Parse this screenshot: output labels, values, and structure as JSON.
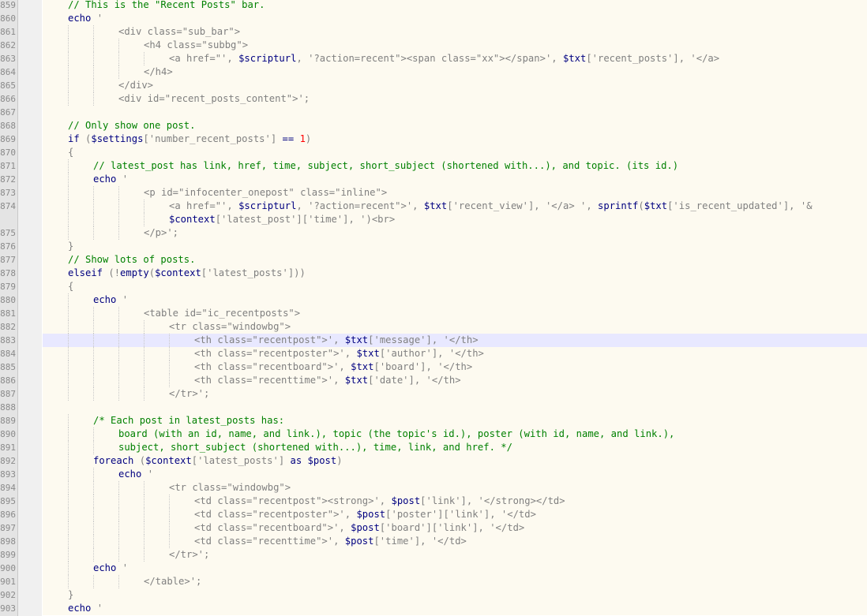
{
  "editor": {
    "language": "php",
    "lines": [
      {
        "n": "859",
        "indent": 1,
        "tokens": [
          [
            "cm",
            "// This is the \"Recent Posts\" bar."
          ]
        ]
      },
      {
        "n": "860",
        "indent": 1,
        "tokens": [
          [
            "kw",
            "echo"
          ],
          [
            "str",
            " '"
          ]
        ]
      },
      {
        "n": "861",
        "indent": 3,
        "tokens": [
          [
            "str",
            "<div class=\"sub_bar\">"
          ]
        ]
      },
      {
        "n": "862",
        "indent": 4,
        "tokens": [
          [
            "str",
            "<h4 class=\"subbg\">"
          ]
        ]
      },
      {
        "n": "863",
        "indent": 5,
        "tokens": [
          [
            "str",
            "<a href=\"', "
          ],
          [
            "var",
            "$scripturl"
          ],
          [
            "str",
            ", '?action=recent\"><span class=\"xx\"></span>', "
          ],
          [
            "var",
            "$txt"
          ],
          [
            "str",
            "['recent_posts'], '</a>"
          ]
        ]
      },
      {
        "n": "864",
        "indent": 4,
        "tokens": [
          [
            "str",
            "</h4>"
          ]
        ]
      },
      {
        "n": "865",
        "indent": 3,
        "tokens": [
          [
            "str",
            "</div>"
          ]
        ]
      },
      {
        "n": "866",
        "indent": 3,
        "tokens": [
          [
            "str",
            "<div id=\"recent_posts_content\">';"
          ]
        ]
      },
      {
        "n": "867",
        "indent": 0,
        "tokens": []
      },
      {
        "n": "868",
        "indent": 1,
        "tokens": [
          [
            "cm",
            "// Only show one post."
          ]
        ]
      },
      {
        "n": "869",
        "indent": 1,
        "tokens": [
          [
            "kw",
            "if"
          ],
          [
            "str",
            " ("
          ],
          [
            "var",
            "$settings"
          ],
          [
            "str",
            "['number_recent_posts'] "
          ],
          [
            "kw",
            "=="
          ],
          [
            "str",
            " "
          ],
          [
            "num2",
            "1"
          ],
          [
            "str",
            ")"
          ]
        ]
      },
      {
        "n": "870",
        "indent": 1,
        "tokens": [
          [
            "str",
            "{"
          ]
        ]
      },
      {
        "n": "871",
        "indent": 2,
        "tokens": [
          [
            "cm",
            "// latest_post has link, href, time, subject, short_subject (shortened with...), and topic. (its id.)"
          ]
        ]
      },
      {
        "n": "872",
        "indent": 2,
        "tokens": [
          [
            "kw",
            "echo"
          ],
          [
            "str",
            " '"
          ]
        ]
      },
      {
        "n": "873",
        "indent": 4,
        "tokens": [
          [
            "str",
            "<p id=\"infocenter_onepost\" class=\"inline\">"
          ]
        ]
      },
      {
        "n": "874",
        "indent": 5,
        "tokens": [
          [
            "str",
            "<a href=\"', "
          ],
          [
            "var",
            "$scripturl"
          ],
          [
            "str",
            ", '?action=recent\">', "
          ],
          [
            "var",
            "$txt"
          ],
          [
            "str",
            "['recent_view'], '</a> ', "
          ],
          [
            "kw",
            "sprintf"
          ],
          [
            "str",
            "("
          ],
          [
            "var",
            "$txt"
          ],
          [
            "str",
            "['is_recent_updated'], '&"
          ]
        ]
      },
      {
        "n": "",
        "indent": 5,
        "tokens": [
          [
            "var",
            "$context"
          ],
          [
            "str",
            "['latest_post']['time'], ')<br>"
          ]
        ]
      },
      {
        "n": "875",
        "indent": 4,
        "tokens": [
          [
            "str",
            "</p>';"
          ]
        ]
      },
      {
        "n": "876",
        "indent": 1,
        "tokens": [
          [
            "str",
            "}"
          ]
        ]
      },
      {
        "n": "877",
        "indent": 1,
        "tokens": [
          [
            "cm",
            "// Show lots of posts."
          ]
        ]
      },
      {
        "n": "878",
        "indent": 1,
        "tokens": [
          [
            "kw",
            "elseif"
          ],
          [
            "str",
            " (!"
          ],
          [
            "kw",
            "empty"
          ],
          [
            "str",
            "("
          ],
          [
            "var",
            "$context"
          ],
          [
            "str",
            "['latest_posts']))"
          ]
        ]
      },
      {
        "n": "879",
        "indent": 1,
        "tokens": [
          [
            "str",
            "{"
          ]
        ]
      },
      {
        "n": "880",
        "indent": 2,
        "tokens": [
          [
            "kw",
            "echo"
          ],
          [
            "str",
            " '"
          ]
        ]
      },
      {
        "n": "881",
        "indent": 4,
        "tokens": [
          [
            "str",
            "<table id=\"ic_recentposts\">"
          ]
        ]
      },
      {
        "n": "882",
        "indent": 5,
        "tokens": [
          [
            "str",
            "<tr class=\"windowbg\">"
          ]
        ]
      },
      {
        "n": "883",
        "indent": 6,
        "current": true,
        "tokens": [
          [
            "str",
            "<th class=\"recentpost\">', "
          ],
          [
            "var",
            "$txt"
          ],
          [
            "str",
            "['message'], '</th>"
          ]
        ]
      },
      {
        "n": "884",
        "indent": 6,
        "tokens": [
          [
            "str",
            "<th class=\"recentposter\">', "
          ],
          [
            "var",
            "$txt"
          ],
          [
            "str",
            "['author'], '</th>"
          ]
        ]
      },
      {
        "n": "885",
        "indent": 6,
        "tokens": [
          [
            "str",
            "<th class=\"recentboard\">', "
          ],
          [
            "var",
            "$txt"
          ],
          [
            "str",
            "['board'], '</th>"
          ]
        ]
      },
      {
        "n": "886",
        "indent": 6,
        "tokens": [
          [
            "str",
            "<th class=\"recenttime\">', "
          ],
          [
            "var",
            "$txt"
          ],
          [
            "str",
            "['date'], '</th>"
          ]
        ]
      },
      {
        "n": "887",
        "indent": 5,
        "tokens": [
          [
            "str",
            "</tr>';"
          ]
        ]
      },
      {
        "n": "888",
        "indent": 0,
        "tokens": []
      },
      {
        "n": "889",
        "indent": 2,
        "tokens": [
          [
            "cm",
            "/* Each post in latest_posts has:"
          ]
        ]
      },
      {
        "n": "890",
        "indent": 3,
        "tokens": [
          [
            "cm",
            "board (with an id, name, and link.), topic (the topic's id.), poster (with id, name, and link.),"
          ]
        ]
      },
      {
        "n": "891",
        "indent": 3,
        "tokens": [
          [
            "cm",
            "subject, short_subject (shortened with...), time, link, and href. */"
          ]
        ]
      },
      {
        "n": "892",
        "indent": 2,
        "tokens": [
          [
            "kw",
            "foreach"
          ],
          [
            "str",
            " ("
          ],
          [
            "var",
            "$context"
          ],
          [
            "str",
            "['latest_posts'] "
          ],
          [
            "kw",
            "as"
          ],
          [
            "str",
            " "
          ],
          [
            "var",
            "$post"
          ],
          [
            "str",
            ")"
          ]
        ]
      },
      {
        "n": "893",
        "indent": 3,
        "tokens": [
          [
            "kw",
            "echo"
          ],
          [
            "str",
            " '"
          ]
        ]
      },
      {
        "n": "894",
        "indent": 5,
        "tokens": [
          [
            "str",
            "<tr class=\"windowbg\">"
          ]
        ]
      },
      {
        "n": "895",
        "indent": 6,
        "tokens": [
          [
            "str",
            "<td class=\"recentpost\"><strong>', "
          ],
          [
            "var",
            "$post"
          ],
          [
            "str",
            "['link'], '</strong></td>"
          ]
        ]
      },
      {
        "n": "896",
        "indent": 6,
        "tokens": [
          [
            "str",
            "<td class=\"recentposter\">', "
          ],
          [
            "var",
            "$post"
          ],
          [
            "str",
            "['poster']['link'], '</td>"
          ]
        ]
      },
      {
        "n": "897",
        "indent": 6,
        "tokens": [
          [
            "str",
            "<td class=\"recentboard\">', "
          ],
          [
            "var",
            "$post"
          ],
          [
            "str",
            "['board']['link'], '</td>"
          ]
        ]
      },
      {
        "n": "898",
        "indent": 6,
        "tokens": [
          [
            "str",
            "<td class=\"recenttime\">', "
          ],
          [
            "var",
            "$post"
          ],
          [
            "str",
            "['time'], '</td>"
          ]
        ]
      },
      {
        "n": "899",
        "indent": 5,
        "tokens": [
          [
            "str",
            "</tr>';"
          ]
        ]
      },
      {
        "n": "900",
        "indent": 2,
        "tokens": [
          [
            "kw",
            "echo"
          ],
          [
            "str",
            " '"
          ]
        ]
      },
      {
        "n": "901",
        "indent": 4,
        "tokens": [
          [
            "str",
            "</table>';"
          ]
        ]
      },
      {
        "n": "902",
        "indent": 1,
        "tokens": [
          [
            "str",
            "}"
          ]
        ]
      },
      {
        "n": "903",
        "indent": 1,
        "tokens": [
          [
            "kw",
            "echo"
          ],
          [
            "str",
            " '"
          ]
        ]
      }
    ]
  },
  "colors": {
    "comment": "#008000",
    "keyword": "#00007f",
    "string": "#808080",
    "variable": "#000080",
    "number": "#ff0000",
    "current_line": "#e8e8ff"
  }
}
